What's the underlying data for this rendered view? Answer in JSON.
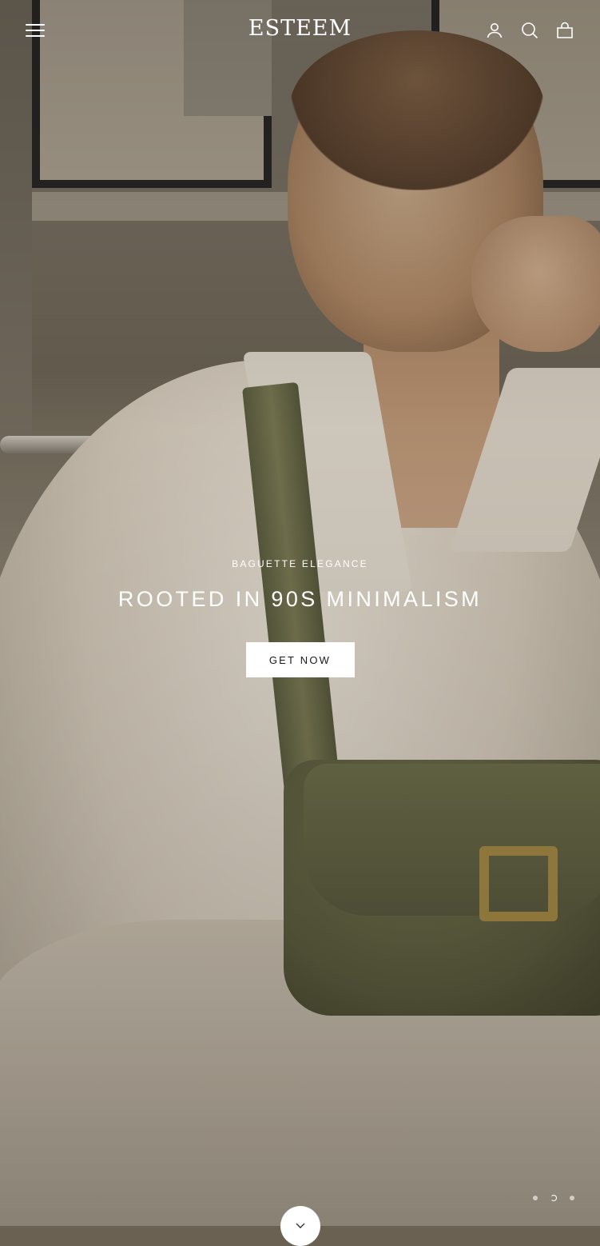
{
  "header": {
    "logo": "ESTEEM",
    "menu_icon": "hamburger-menu-icon",
    "account_icon": "user-icon",
    "search_icon": "search-icon",
    "cart_icon": "shopping-bag-icon"
  },
  "hero": {
    "eyebrow": "BAGUETTE ELEGANCE",
    "headline": "ROOTED IN 90S MINIMALISM",
    "cta_label": "GET NOW",
    "slide_count": 3,
    "active_slide": 2,
    "scroll_icon": "chevron-down-icon"
  },
  "colors": {
    "text_on_image": "#ffffff",
    "button_bg": "#ffffff",
    "button_text": "#1a1a1a"
  }
}
